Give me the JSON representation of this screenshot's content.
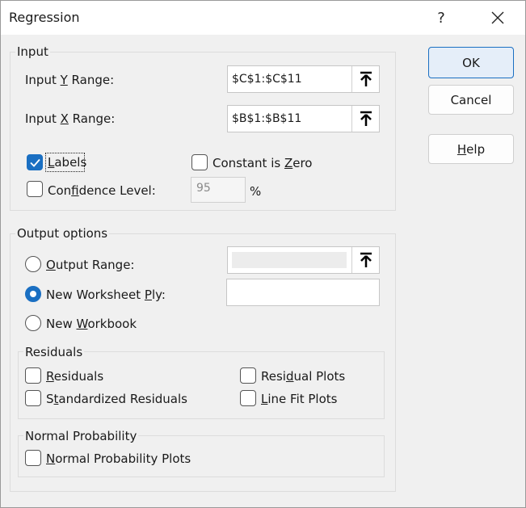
{
  "window": {
    "title": "Regression",
    "help_glyph": "?",
    "close_glyph": "✕"
  },
  "input_group": {
    "label": "Input",
    "y_range": {
      "pre": "Input ",
      "key": "Y",
      "post": " Range:",
      "value": "$C$1:$C$11"
    },
    "x_range": {
      "pre": "Input ",
      "key": "X",
      "post": " Range:",
      "value": "$B$1:$B$11"
    },
    "labels": {
      "key": "L",
      "post": "abels",
      "checked": true
    },
    "constant_zero": {
      "pre": "Constant is ",
      "key": "Z",
      "post": "ero",
      "checked": false
    },
    "confidence": {
      "pre": "Con",
      "key": "f",
      "post": "idence Level:",
      "value": "95",
      "unit": "%",
      "checked": false
    }
  },
  "output_group": {
    "label": "Output options",
    "output_range": {
      "key": "O",
      "post": "utput Range:",
      "value": "",
      "selected": false
    },
    "new_ply": {
      "pre": "New Worksheet ",
      "key": "P",
      "post": "ly:",
      "value": "",
      "selected": true
    },
    "new_workbook": {
      "pre": "New ",
      "key": "W",
      "post": "orkbook",
      "selected": false
    }
  },
  "residuals_group": {
    "label": "Residuals",
    "residuals": {
      "key": "R",
      "post": "esiduals",
      "checked": false
    },
    "standardized": {
      "pre": "S",
      "key": "t",
      "post": "andardized Residuals",
      "checked": false
    },
    "residual_plots": {
      "pre": "Resi",
      "key": "d",
      "post": "ual Plots",
      "checked": false
    },
    "line_fit": {
      "key": "L",
      "post": "ine Fit Plots",
      "checked": false
    }
  },
  "normal_group": {
    "label": "Normal Probability",
    "normal_plots": {
      "key": "N",
      "post": "ormal Probability Plots",
      "checked": false
    }
  },
  "buttons": {
    "ok": "OK",
    "cancel": "Cancel",
    "help": {
      "key": "H",
      "post": "elp"
    }
  },
  "colors": {
    "accent": "#1a6fc2",
    "dialog_bg": "#f0f0f0"
  },
  "icons": {
    "ref_button": "arrow-up-icon",
    "close": "close-icon",
    "help": "question-icon"
  }
}
